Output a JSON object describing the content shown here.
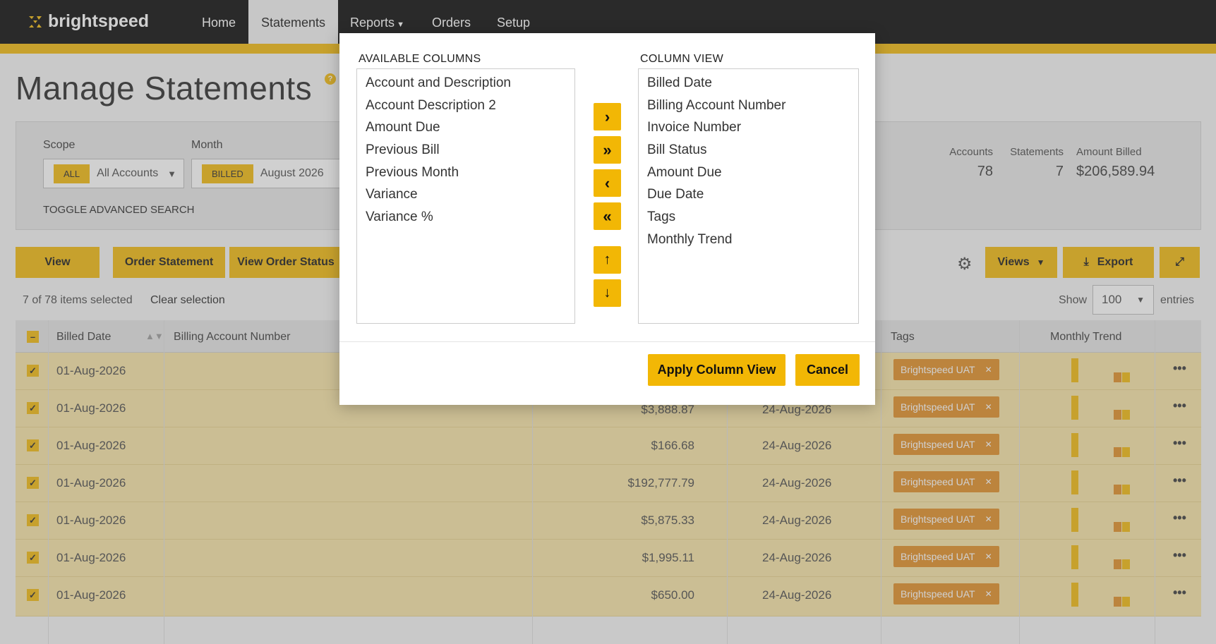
{
  "brand": {
    "name": "brightspeed"
  },
  "nav": [
    {
      "label": "Home"
    },
    {
      "label": "Statements"
    },
    {
      "label": "Reports"
    },
    {
      "label": "Orders"
    },
    {
      "label": "Setup"
    }
  ],
  "page": {
    "title": "Manage Statements",
    "help": "?"
  },
  "filters": {
    "scope_label": "Scope",
    "scope_chip": "ALL",
    "scope_value": "All Accounts",
    "month_label": "Month",
    "month_chip": "BILLED",
    "month_value": "August 2026",
    "toggle_advanced": "TOGGLE ADVANCED SEARCH"
  },
  "stats": [
    {
      "label": "Accounts",
      "value": "78"
    },
    {
      "label": "Statements",
      "value": "7"
    },
    {
      "label": "Amount Billed",
      "value": "$206,589.94"
    }
  ],
  "toolbar": {
    "view": "View",
    "order_statement": "Order Statement",
    "view_order_status": "View Order Status",
    "views": "Views",
    "export": "Export"
  },
  "selection": {
    "info": "7 of 78 items selected",
    "clear": "Clear selection"
  },
  "paging": {
    "show": "Show",
    "value": "100",
    "entries": "entries"
  },
  "table": {
    "headers": {
      "billed_date": "Billed Date",
      "billing_account": "Billing Account Number",
      "tags": "Tags",
      "monthly_trend": "Monthly Trend"
    },
    "rows": [
      {
        "date": "01-Aug-2026",
        "amount": "",
        "due": "",
        "tag": "Brightspeed UAT"
      },
      {
        "date": "01-Aug-2026",
        "amount": "$3,888.87",
        "due": "24-Aug-2026",
        "tag": "Brightspeed UAT"
      },
      {
        "date": "01-Aug-2026",
        "amount": "$166.68",
        "due": "24-Aug-2026",
        "tag": "Brightspeed UAT"
      },
      {
        "date": "01-Aug-2026",
        "amount": "$192,777.79",
        "due": "24-Aug-2026",
        "tag": "Brightspeed UAT"
      },
      {
        "date": "01-Aug-2026",
        "amount": "$5,875.33",
        "due": "24-Aug-2026",
        "tag": "Brightspeed UAT"
      },
      {
        "date": "01-Aug-2026",
        "amount": "$1,995.11",
        "due": "24-Aug-2026",
        "tag": "Brightspeed UAT"
      },
      {
        "date": "01-Aug-2026",
        "amount": "$650.00",
        "due": "24-Aug-2026",
        "tag": "Brightspeed UAT"
      }
    ]
  },
  "modal": {
    "available_heading": "AVAILABLE COLUMNS",
    "view_heading": "COLUMN VIEW",
    "available": [
      "Account and Description",
      "Account Description 2",
      "Amount Due",
      "Previous Bill",
      "Previous Month",
      "Variance",
      "Variance %"
    ],
    "selected": [
      "Billed Date",
      "Billing Account Number",
      "Invoice Number",
      "Bill Status",
      "Amount Due",
      "Due Date",
      "Tags",
      "Monthly Trend"
    ],
    "apply": "Apply Column View",
    "cancel": "Cancel"
  },
  "colors": {
    "accent": "#f2b705",
    "tag": "#e08a1e",
    "nav_bg": "#000000"
  }
}
